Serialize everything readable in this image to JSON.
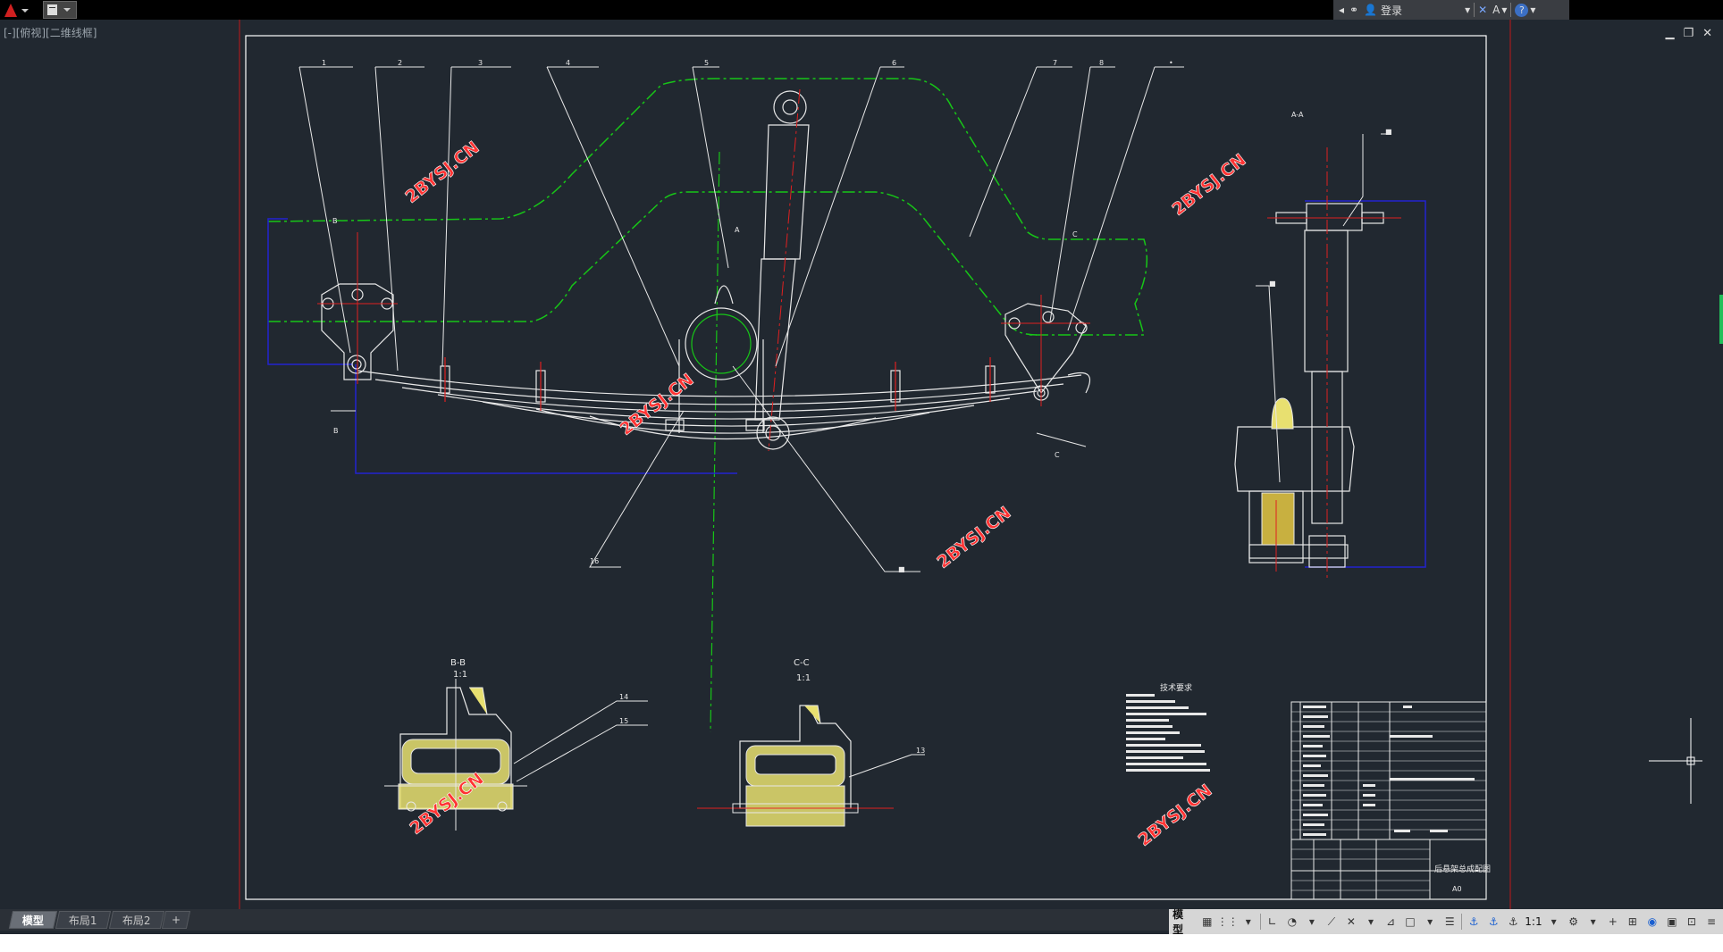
{
  "app": {
    "title": "AutoCAD"
  },
  "infocenter": {
    "login_label": "登录",
    "help_label": "?"
  },
  "viewport": {
    "label": "[-][俯视][二维线框]"
  },
  "drawing": {
    "leader_numbers": [
      "1",
      "2",
      "3",
      "4",
      "5",
      "6",
      "7",
      "8",
      "•"
    ],
    "section_aa": "A-A",
    "section_bb": "B-B",
    "section_bb_scale": "1:1",
    "section_cc": "C-C",
    "section_cc_scale": "1:1",
    "label_b_top": "B",
    "label_b_bottom": "B",
    "label_c_top": "C",
    "label_c_bottom": "C",
    "label_a": "A",
    "callout_16": "16",
    "callout_14": "14",
    "callout_15": "15",
    "callout_13": "13",
    "callout_sq": "■",
    "callout_dot1": "■",
    "callout_dot2": "■",
    "tech_requirements_title": "技术要求",
    "title_block_name": "后悬架总成配图",
    "title_block_code": "A0",
    "watermark": "2BYSJ.CN"
  },
  "tabs": [
    {
      "label": "模型",
      "active": true
    },
    {
      "label": "布局1",
      "active": false
    },
    {
      "label": "布局2",
      "active": false
    },
    {
      "label": "+",
      "active": false
    }
  ],
  "statusbar": {
    "model_label": "模型",
    "scale_label": "1:1"
  },
  "colors": {
    "bg": "#212830",
    "frame": "#ffffff",
    "green": "#17c617",
    "red": "#e02020",
    "blue": "#1a1ad0",
    "hatch": "#e8e070",
    "watermark": "#ff3333"
  }
}
